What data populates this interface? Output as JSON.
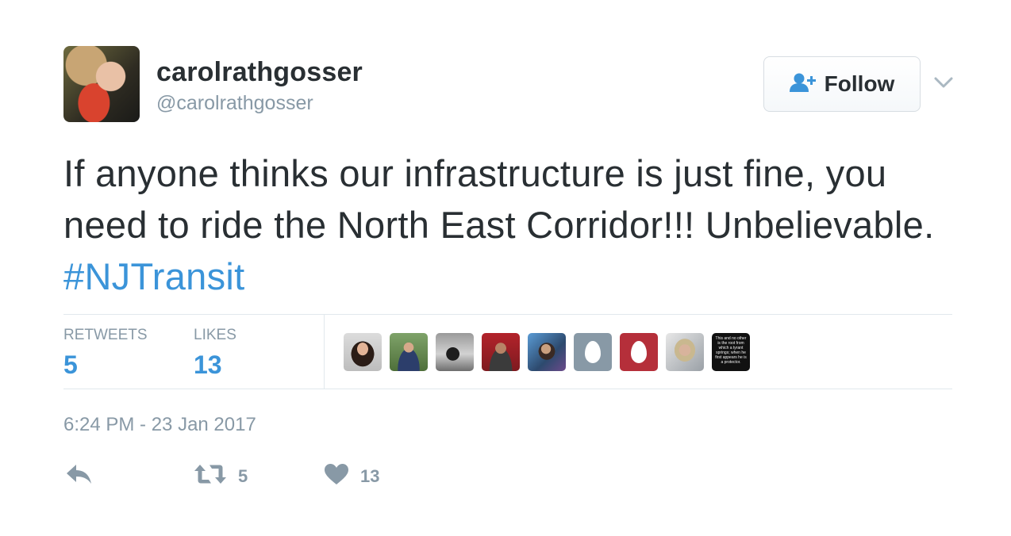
{
  "tweet": {
    "display_name": "carolrathgosser",
    "handle": "@carolrathgosser",
    "text_before": "If anyone thinks our infrastructure is just fine, you need to ride the North East Corridor!!! Unbelievable.",
    "hashtag": "#NJTransit",
    "timestamp": "6:24 PM - 23 Jan 2017"
  },
  "follow_button": {
    "label": "Follow",
    "icon": "follow-person-plus-icon"
  },
  "stats": {
    "retweets_label": "RETWEETS",
    "retweets_value": "5",
    "likes_label": "LIKES",
    "likes_value": "13"
  },
  "likers": [
    {
      "name": "liker-avatar-1",
      "style": "woman-dark-hair"
    },
    {
      "name": "liker-avatar-2",
      "style": "man-outdoors"
    },
    {
      "name": "liker-avatar-3",
      "style": "horse-racing"
    },
    {
      "name": "liker-avatar-4",
      "style": "man-red-background"
    },
    {
      "name": "liker-avatar-5",
      "style": "woman-selfie"
    },
    {
      "name": "liker-avatar-6",
      "style": "default-egg-gray"
    },
    {
      "name": "liker-avatar-7",
      "style": "default-egg-red"
    },
    {
      "name": "liker-avatar-8",
      "style": "woman-light-hair"
    },
    {
      "name": "liker-avatar-9",
      "style": "quote-image",
      "text": "This and no other is the root from which a tyrant springs; when he first appears he is a protector."
    }
  ],
  "actions": {
    "reply_icon": "reply-arrow-icon",
    "retweet_icon": "retweet-icon",
    "retweet_count": "5",
    "like_icon": "heart-icon",
    "like_count": "13"
  },
  "colors": {
    "accent": "#3b94d9",
    "text": "#292f33",
    "muted": "#8899a6",
    "divider": "#e1e8ed"
  }
}
